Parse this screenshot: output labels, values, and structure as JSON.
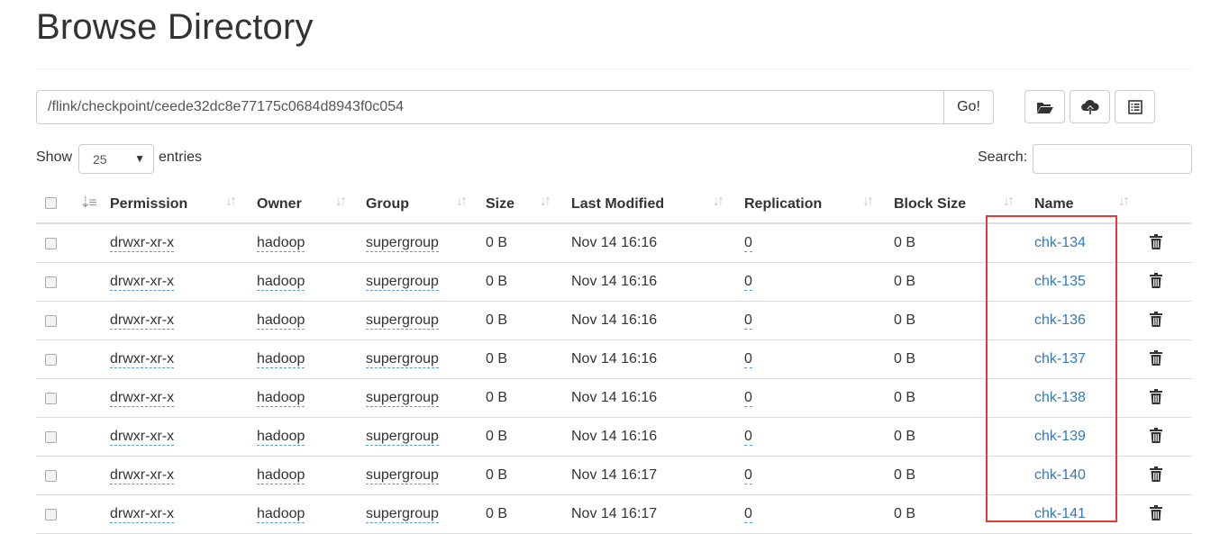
{
  "page": {
    "title": "Browse Directory"
  },
  "path_bar": {
    "path_value": "/flink/checkpoint/ceede32dc8e77175c0684d8943f0c054",
    "go_label": "Go!",
    "tools": [
      {
        "icon": "folder-open-icon"
      },
      {
        "icon": "cloud-upload-icon"
      },
      {
        "icon": "list-alt-icon"
      }
    ]
  },
  "controls": {
    "show_label": "Show",
    "entries_value": "25",
    "entries_label": "entries",
    "search_label": "Search:",
    "search_value": ""
  },
  "table": {
    "columns": [
      "Permission",
      "Owner",
      "Group",
      "Size",
      "Last Modified",
      "Replication",
      "Block Size",
      "Name"
    ],
    "rows": [
      {
        "permission": "drwxr-xr-x",
        "owner": "hadoop",
        "group": "supergroup",
        "size": "0 B",
        "last_modified": "Nov 14 16:16",
        "replication": "0",
        "block_size": "0 B",
        "name": "chk-134"
      },
      {
        "permission": "drwxr-xr-x",
        "owner": "hadoop",
        "group": "supergroup",
        "size": "0 B",
        "last_modified": "Nov 14 16:16",
        "replication": "0",
        "block_size": "0 B",
        "name": "chk-135"
      },
      {
        "permission": "drwxr-xr-x",
        "owner": "hadoop",
        "group": "supergroup",
        "size": "0 B",
        "last_modified": "Nov 14 16:16",
        "replication": "0",
        "block_size": "0 B",
        "name": "chk-136"
      },
      {
        "permission": "drwxr-xr-x",
        "owner": "hadoop",
        "group": "supergroup",
        "size": "0 B",
        "last_modified": "Nov 14 16:16",
        "replication": "0",
        "block_size": "0 B",
        "name": "chk-137"
      },
      {
        "permission": "drwxr-xr-x",
        "owner": "hadoop",
        "group": "supergroup",
        "size": "0 B",
        "last_modified": "Nov 14 16:16",
        "replication": "0",
        "block_size": "0 B",
        "name": "chk-138"
      },
      {
        "permission": "drwxr-xr-x",
        "owner": "hadoop",
        "group": "supergroup",
        "size": "0 B",
        "last_modified": "Nov 14 16:16",
        "replication": "0",
        "block_size": "0 B",
        "name": "chk-139"
      },
      {
        "permission": "drwxr-xr-x",
        "owner": "hadoop",
        "group": "supergroup",
        "size": "0 B",
        "last_modified": "Nov 14 16:17",
        "replication": "0",
        "block_size": "0 B",
        "name": "chk-140"
      },
      {
        "permission": "drwxr-xr-x",
        "owner": "hadoop",
        "group": "supergroup",
        "size": "0 B",
        "last_modified": "Nov 14 16:17",
        "replication": "0",
        "block_size": "0 B",
        "name": "chk-141"
      }
    ]
  },
  "colors": {
    "link": "#337ab7",
    "highlight": "#e53935",
    "border": "#dddddd"
  }
}
